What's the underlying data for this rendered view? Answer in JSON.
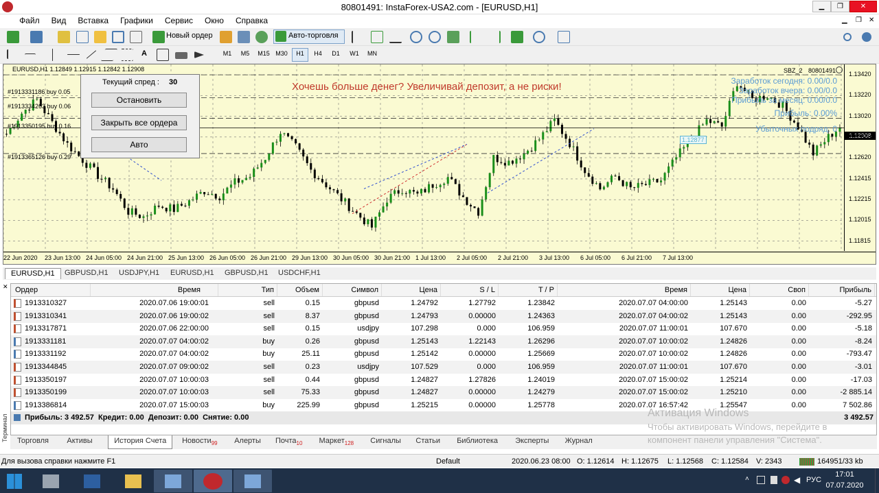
{
  "window": {
    "title": "80801491: InstaForex-USA2.com - [EURUSD,H1]"
  },
  "menu": [
    "Файл",
    "Вид",
    "Вставка",
    "Графики",
    "Сервис",
    "Окно",
    "Справка"
  ],
  "toolbar": {
    "new_order": "Новый ордер",
    "auto_trading": "Авто-торговля"
  },
  "timeframes": [
    "M1",
    "M5",
    "M15",
    "M30",
    "H1",
    "H4",
    "D1",
    "W1",
    "MN"
  ],
  "chart": {
    "symbol_line": "EURUSD,H1  1.12849 1.12915 1.12842 1.12908",
    "ad_text": "Хочешь больше денег? Увеличивай депозит, а не риски!",
    "ea_name": "SBZ_2",
    "account": "80801491",
    "current_price": "1.12908",
    "box_price": "1.12877",
    "price_ticks": [
      "1.13420",
      "1.13220",
      "1.13020",
      "1.12820",
      "1.12620",
      "1.12415",
      "1.12215",
      "1.12015",
      "1.11815"
    ],
    "time_ticks": [
      "22 Jun 2020",
      "23 Jun 13:00",
      "24 Jun 05:00",
      "24 Jun 21:00",
      "25 Jun 13:00",
      "26 Jun 05:00",
      "26 Jun 21:00",
      "29 Jun 13:00",
      "30 Jun 05:00",
      "30 Jun 21:00",
      "1 Jul 13:00",
      "2 Jul 05:00",
      "2 Jul 21:00",
      "3 Jul 13:00",
      "6 Jul 05:00",
      "6 Jul 21:00",
      "7 Jul 13:00"
    ],
    "order_labels": [
      "#1913331186 buy 0.05",
      "#1913334263 buy 0.06",
      "#1913350195 buy 0.16",
      "#1913365126 buy 0.29"
    ],
    "stats": [
      "Заработок сегодня: 0.00/0.0",
      "Заработок вчера: 0.00/0.0",
      "Прибыль за месяц: 0.00/0.0",
      "Прибыль: 0.00%",
      "Убыточных подряд: 0"
    ],
    "spread_label": "Текущий спред :",
    "spread_value": "30",
    "buttons": [
      "Остановить",
      "Закрыть все ордера",
      "Авто"
    ],
    "candles": [
      1.1285,
      1.1305,
      1.1318,
      1.1296,
      1.1275,
      1.126,
      1.1245,
      1.1232,
      1.121,
      1.1205,
      1.1216,
      1.1212,
      1.122,
      1.123,
      1.1225,
      1.1238,
      1.1244,
      1.1262,
      1.1287,
      1.1272,
      1.125,
      1.1236,
      1.1222,
      1.1208,
      1.1195,
      1.1222,
      1.1232,
      1.1226,
      1.1236,
      1.1243,
      1.1224,
      1.121,
      1.1262,
      1.1258,
      1.1266,
      1.128,
      1.1298,
      1.1276,
      1.125,
      1.1232,
      1.1244,
      1.1232,
      1.1236,
      1.124,
      1.1262,
      1.128,
      1.1298,
      1.1292,
      1.1335,
      1.1318,
      1.1322,
      1.1312,
      1.1292,
      1.1266,
      1.1282,
      1.1295
    ]
  },
  "chart_tabs": [
    "EURUSD,H1",
    "GBPUSD,H1",
    "USDJPY,H1",
    "EURUSD,H1",
    "GBPUSD,H1",
    "USDCHF,H1"
  ],
  "terminal": {
    "side_label": "Терминал",
    "columns": [
      "Ордер",
      "Время",
      "Тип",
      "Объем",
      "Символ",
      "Цена",
      "S / L",
      "T / P",
      "Время",
      "Цена",
      "Своп",
      "Прибыль"
    ],
    "rows": [
      [
        "1913310327",
        "2020.07.06 19:00:01",
        "sell",
        "0.15",
        "gbpusd",
        "1.24792",
        "1.27792",
        "1.23842",
        "2020.07.07 04:00:00",
        "1.25143",
        "0.00",
        "-5.27"
      ],
      [
        "1913310341",
        "2020.07.06 19:00:02",
        "sell",
        "8.37",
        "gbpusd",
        "1.24793",
        "0.00000",
        "1.24363",
        "2020.07.07 04:00:02",
        "1.25143",
        "0.00",
        "-292.95"
      ],
      [
        "1913317871",
        "2020.07.06 22:00:00",
        "sell",
        "0.15",
        "usdjpy",
        "107.298",
        "0.000",
        "106.959",
        "2020.07.07 11:00:01",
        "107.670",
        "0.00",
        "-5.18"
      ],
      [
        "1913331181",
        "2020.07.07 04:00:02",
        "buy",
        "0.26",
        "gbpusd",
        "1.25143",
        "1.22143",
        "1.26296",
        "2020.07.07 10:00:02",
        "1.24826",
        "0.00",
        "-8.24"
      ],
      [
        "1913331192",
        "2020.07.07 04:00:02",
        "buy",
        "25.11",
        "gbpusd",
        "1.25142",
        "0.00000",
        "1.25669",
        "2020.07.07 10:00:02",
        "1.24826",
        "0.00",
        "-793.47"
      ],
      [
        "1913344845",
        "2020.07.07 09:00:02",
        "sell",
        "0.23",
        "usdjpy",
        "107.529",
        "0.000",
        "106.959",
        "2020.07.07 11:00:01",
        "107.670",
        "0.00",
        "-3.01"
      ],
      [
        "1913350197",
        "2020.07.07 10:00:03",
        "sell",
        "0.44",
        "gbpusd",
        "1.24827",
        "1.27826",
        "1.24019",
        "2020.07.07 15:00:02",
        "1.25214",
        "0.00",
        "-17.03"
      ],
      [
        "1913350199",
        "2020.07.07 10:00:03",
        "sell",
        "75.33",
        "gbpusd",
        "1.24827",
        "0.00000",
        "1.24279",
        "2020.07.07 15:00:02",
        "1.25210",
        "0.00",
        "-2 885.14"
      ],
      [
        "1913386814",
        "2020.07.07 15:00:03",
        "buy",
        "225.99",
        "gbpusd",
        "1.25215",
        "0.00000",
        "1.25778",
        "2020.07.07 16:57:42",
        "1.25547",
        "0.00",
        "7 502.86"
      ]
    ],
    "summary": "Прибыль: 3 492.57  Кредит: 0.00  Депозит: 0.00  Снятие: 0.00",
    "summary_total": "3 492.57",
    "tabs": [
      {
        "label": "Торговля",
        "badge": ""
      },
      {
        "label": "Активы",
        "badge": ""
      },
      {
        "label": "История Счета",
        "badge": ""
      },
      {
        "label": "Новости",
        "badge": "99"
      },
      {
        "label": "Алерты",
        "badge": ""
      },
      {
        "label": "Почта",
        "badge": "10"
      },
      {
        "label": "Маркет",
        "badge": "128"
      },
      {
        "label": "Сигналы",
        "badge": ""
      },
      {
        "label": "Статьи",
        "badge": ""
      },
      {
        "label": "Библиотека",
        "badge": ""
      },
      {
        "label": "Эксперты",
        "badge": ""
      },
      {
        "label": "Журнал",
        "badge": ""
      }
    ]
  },
  "watermark": {
    "title": "Активация Windows",
    "line1": "Чтобы активировать Windows, перейдите в",
    "line2": "компонент панели управления \"Система\"."
  },
  "status": {
    "help": "Для вызова справки нажмите F1",
    "profile": "Default",
    "datetime": "2020.06.23 08:00",
    "open": "O: 1.12614",
    "high": "H: 1.12675",
    "low": "L: 1.12568",
    "close": "C: 1.12584",
    "volume": "V: 2343",
    "traffic": "164951/33 kb"
  },
  "taskbar": {
    "lang": "РУС",
    "time": "17:01",
    "date": "07.07.2020"
  },
  "colors": {
    "chart_bg": "#fafad2",
    "bull": "#1a8f1a",
    "bear": "#000000",
    "ad": "#c0392b",
    "info": "#5a9bd4",
    "taskbar": "#1f3047"
  }
}
